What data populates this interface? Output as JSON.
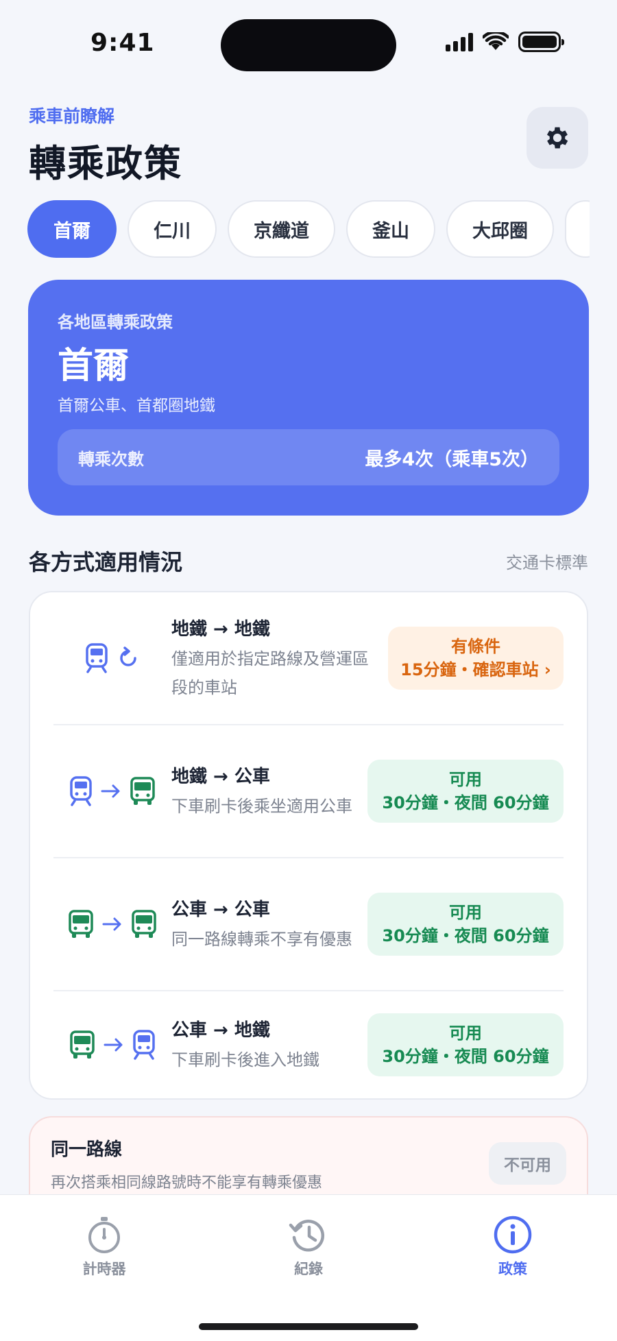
{
  "status": {
    "time": "9:41"
  },
  "header": {
    "eyebrow": "乘車前瞭解",
    "title": "轉乘政策"
  },
  "regions": [
    "首爾",
    "仁川",
    "京纖道",
    "釜山",
    "大邱圈"
  ],
  "hero": {
    "label": "各地區轉乘政策",
    "region": "首爾",
    "desc": "首爾公車、首都圈地鐵",
    "row_label": "轉乘次數",
    "row_value": "最多4次（乘車5次）"
  },
  "section": {
    "title": "各方式適用情況",
    "note": "交通卡標準"
  },
  "modes": [
    {
      "title": "地鐵 → 地鐵",
      "desc": "僅適用於指定路線及營運區段的車站",
      "status": "有條件",
      "detail": "15分鐘・確認車站 ›",
      "from_icon": "subway-icon",
      "to_icon": "reload-icon"
    },
    {
      "title": "地鐵 → 公車",
      "desc": "下車刷卡後乘坐適用公車",
      "status": "可用",
      "detail": "30分鐘・夜間 60分鐘",
      "from_icon": "subway-icon",
      "to_icon": "bus-icon"
    },
    {
      "title": "公車 → 公車",
      "desc": "同一路線轉乘不享有優惠",
      "status": "可用",
      "detail": "30分鐘・夜間 60分鐘",
      "from_icon": "bus-icon",
      "to_icon": "bus-icon"
    },
    {
      "title": "公車 → 地鐵",
      "desc": "下車刷卡後進入地鐵",
      "status": "可用",
      "detail": "30分鐘・夜間 60分鐘",
      "from_icon": "bus-icon",
      "to_icon": "subway-icon"
    }
  ],
  "same_route": {
    "title": "同一路線",
    "desc": "再次搭乘相同線路號時不能享有轉乘優惠",
    "badge": "不可用"
  },
  "tabs": [
    {
      "label": "計時器",
      "icon": "stopwatch-icon",
      "active": false
    },
    {
      "label": "紀錄",
      "icon": "history-icon",
      "active": false
    },
    {
      "label": "政策",
      "icon": "info-icon",
      "active": true
    }
  ],
  "colors": {
    "accent": "#4f6df0",
    "warn": "#d9650f",
    "ok": "#168a52",
    "bus": "#1e8a57",
    "subway": "#5570f0"
  }
}
